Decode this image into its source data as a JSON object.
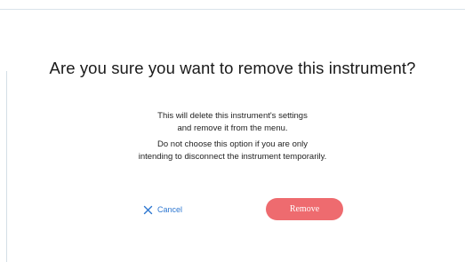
{
  "dialog": {
    "title": "Are you sure you want to remove this instrument?",
    "message_lines": [
      "This will delete this instrument's settings",
      "and remove it from the menu.",
      "Do not choose this option if you are only",
      "intending to disconnect the instrument temporarily."
    ],
    "cancel_label": "Cancel",
    "cancel_icon": "close-icon",
    "remove_label": "Remove"
  },
  "colors": {
    "accent_link": "#2f78d1",
    "remove_button": "#ee6b6f",
    "text": "#1a1a1a"
  }
}
